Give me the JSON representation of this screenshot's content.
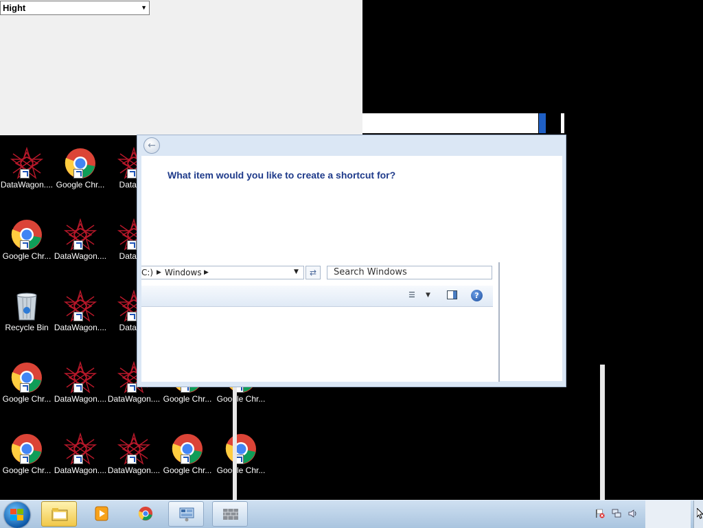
{
  "top_select": {
    "value": "Hight"
  },
  "dialog": {
    "heading": "What item would you like to create a shortcut for?",
    "address_segments": [
      "C:)",
      "Windows"
    ],
    "search_placeholder": "Search Windows",
    "help_glyph": "?"
  },
  "desktop_icons": [
    {
      "label": "DataWagon....",
      "icon": "datawagon-icon",
      "shortcut": true
    },
    {
      "label": "Google Chr...",
      "icon": "chrome-icon",
      "shortcut": true
    },
    {
      "label": "DataWa",
      "icon": "datawagon-icon",
      "shortcut": true
    },
    {
      "label": "Google Chr...",
      "icon": "chrome-icon",
      "shortcut": true
    },
    {
      "label": "DataWagon....",
      "icon": "datawagon-icon",
      "shortcut": true
    },
    {
      "label": "DataWa",
      "icon": "datawagon-icon",
      "shortcut": true
    },
    {
      "label": "Recycle Bin",
      "icon": "recycle-bin-icon",
      "shortcut": false
    },
    {
      "label": "DataWagon....",
      "icon": "datawagon-icon",
      "shortcut": true
    },
    {
      "label": "DataWa",
      "icon": "datawagon-icon",
      "shortcut": true
    },
    {
      "label": "Google Chr...",
      "icon": "chrome-icon",
      "shortcut": true
    },
    {
      "label": "DataWagon....",
      "icon": "datawagon-icon",
      "shortcut": true
    },
    {
      "label": "DataWagon....",
      "icon": "datawagon-icon",
      "shortcut": true
    },
    {
      "label": "Google Chr...",
      "icon": "chrome-icon",
      "shortcut": true
    },
    {
      "label": "Google Chr...",
      "icon": "chrome-icon",
      "shortcut": true
    },
    {
      "label": "Google Chr...",
      "icon": "chrome-icon",
      "shortcut": true
    },
    {
      "label": "DataWagon....",
      "icon": "datawagon-icon",
      "shortcut": true
    },
    {
      "label": "DataWagon....",
      "icon": "datawagon-icon",
      "shortcut": true
    },
    {
      "label": "Google Chr...",
      "icon": "chrome-icon",
      "shortcut": true
    },
    {
      "label": "Google Chr...",
      "icon": "chrome-icon",
      "shortcut": true
    }
  ],
  "taskbar": {
    "buttons": [
      "windows-explorer-icon",
      "media-player-icon",
      "chrome-icon",
      "control-panel-icon",
      "firewall-icon"
    ],
    "tray_icons": [
      "action-center-flag-icon",
      "network-icon",
      "volume-icon"
    ]
  },
  "colors": {
    "heading": "#1e3a8a",
    "taskbar": "#a9c4df",
    "desktop": "#000000"
  }
}
